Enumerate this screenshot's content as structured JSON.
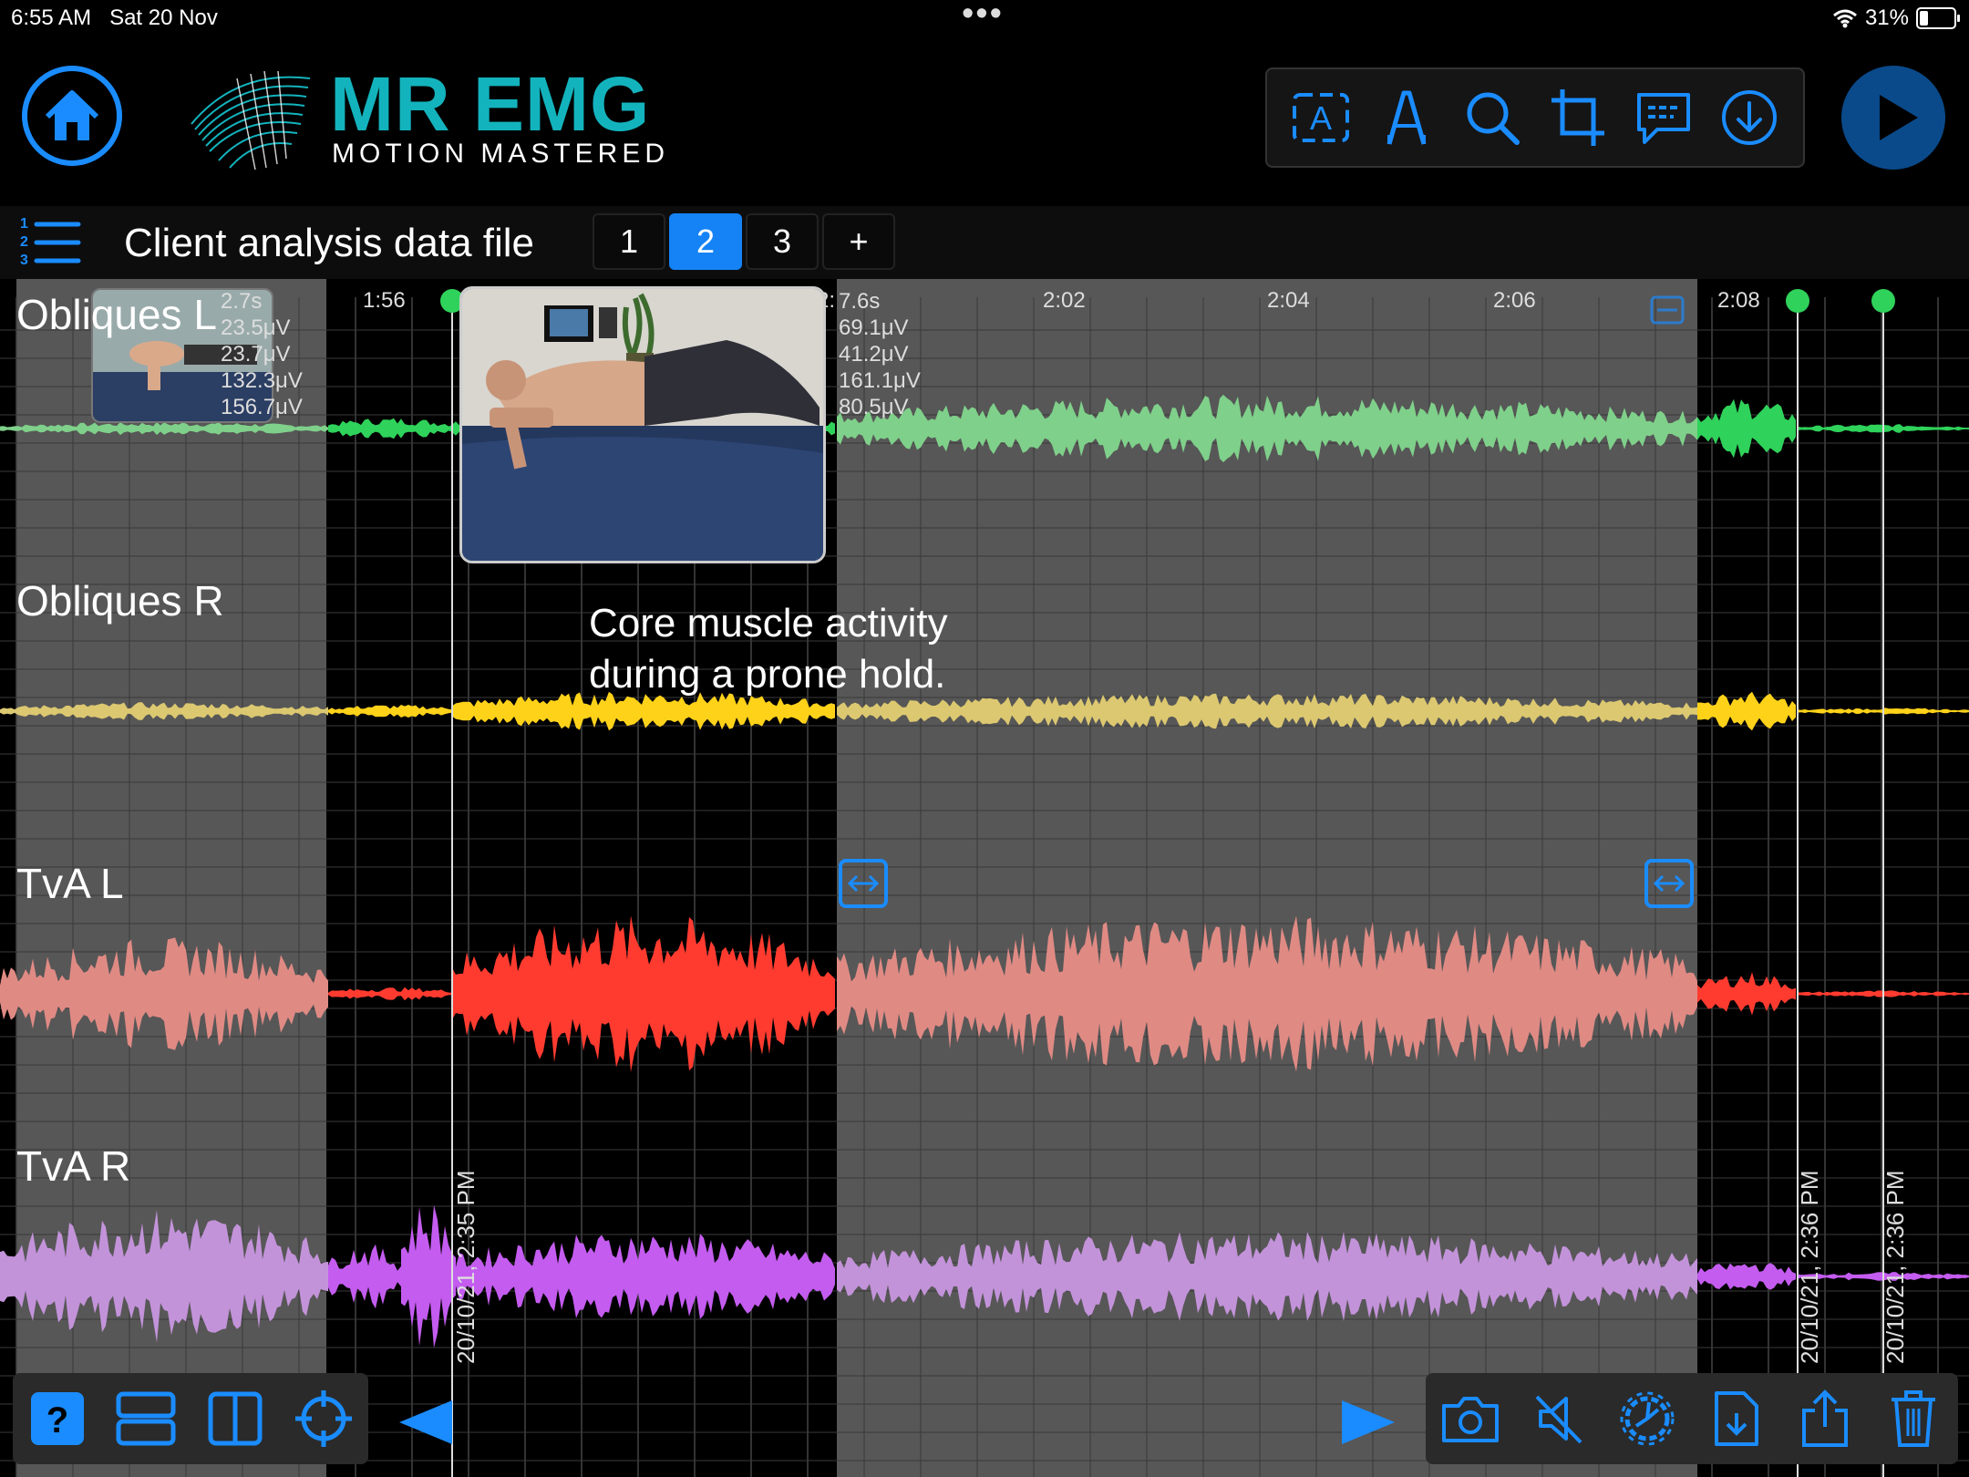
{
  "status": {
    "time": "6:55 AM",
    "date": "Sat 20 Nov",
    "dots": "•••",
    "battery": "31%"
  },
  "brand": {
    "name": "MR EMG",
    "tagline": "MOTION MASTERED",
    "accent": "#13b3bd",
    "blue": "#1583f5"
  },
  "toolbar": {
    "icons": [
      "text-annotation-icon",
      "pen-icon",
      "search-icon",
      "crop-icon",
      "comment-icon",
      "download-icon"
    ]
  },
  "file": {
    "title": "Client analysis data file",
    "tabs": [
      "1",
      "2",
      "3",
      "+"
    ],
    "active_tab": "2"
  },
  "chart": {
    "time_ticks": [
      "1:56",
      "2:02",
      "2:04",
      "2:06",
      "2:08"
    ],
    "partial_tick": "2:",
    "channels": [
      {
        "name": "Obliques L",
        "color": "#2fd25a",
        "muted_color": "#7fd08a"
      },
      {
        "name": "Obliques R",
        "color": "#ffd21a",
        "muted_color": "#dcc870"
      },
      {
        "name": "TvA L",
        "color": "#ff3b30",
        "muted_color": "#e08a84"
      },
      {
        "name": "TvA R",
        "color": "#c45cf0",
        "muted_color": "#c393da"
      }
    ],
    "stats_left": [
      "2.7s",
      "23.5μV",
      "23.7μV",
      "132.3μV",
      "156.7μV"
    ],
    "stats_right": [
      "7.6s",
      "69.1μV",
      "41.2μV",
      "161.1μV",
      "80.5μV"
    ],
    "annotation_line1": "Core muscle activity",
    "annotation_line2": "during a prone hold.",
    "dates": [
      "20/10/21, 2:35 PM",
      "20/10/21, 2:36 PM",
      "20/10/21, 2:36 PM"
    ]
  },
  "bottom_left": {
    "icons": [
      "help-icon",
      "split-horizontal-icon",
      "split-vertical-icon",
      "crosshair-icon"
    ],
    "help_label": "?"
  },
  "bottom_right": {
    "icons": [
      "camera-icon",
      "mute-icon",
      "settings-icon",
      "import-file-icon",
      "share-icon",
      "trash-icon"
    ]
  }
}
